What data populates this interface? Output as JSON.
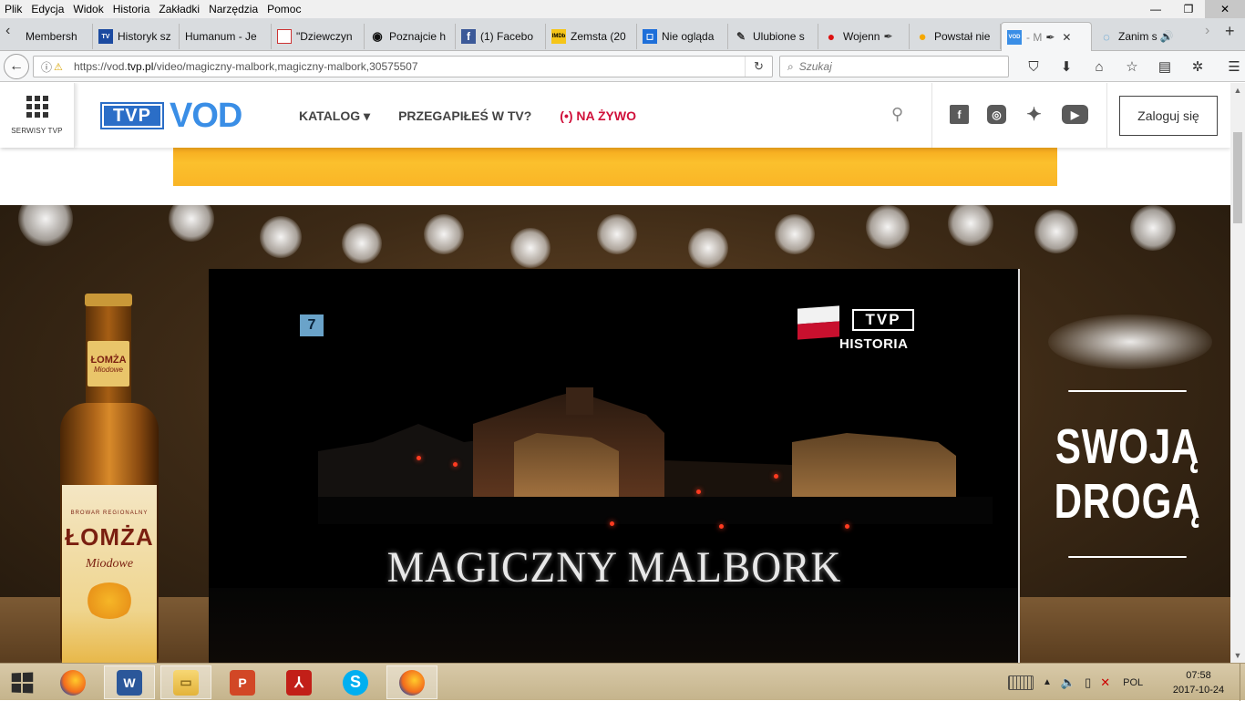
{
  "menubar": {
    "items": [
      "Plik",
      "Edycja",
      "Widok",
      "Historia",
      "Zakładki",
      "Narzędzia",
      "Pomoc"
    ]
  },
  "window_controls": {
    "minimize": "—",
    "restore": "❐",
    "close": "✕"
  },
  "tabs": [
    {
      "label": "Membersh",
      "icon": "chevron-left-icon"
    },
    {
      "label": "Historyk sz",
      "fav": "TV"
    },
    {
      "label": "Humanum - Je",
      "fav": ""
    },
    {
      "label": "\"Dziewczyn",
      "fav": ""
    },
    {
      "label": "Poznajcie h",
      "fav": "◉"
    },
    {
      "label": "(1) Facebo",
      "fav": "f"
    },
    {
      "label": "Zemsta (20",
      "fav": "IMDb"
    },
    {
      "label": "Nie ogląda",
      "fav": "◻"
    },
    {
      "label": "Ulubione s",
      "fav": "✎"
    },
    {
      "label": "Wojenn",
      "fav": "●"
    },
    {
      "label": "Powstał nie",
      "fav": "●"
    },
    {
      "label": "- M",
      "fav": "VOD"
    },
    {
      "label": "Zanim s",
      "fav": "◌"
    }
  ],
  "navbar": {
    "url_prefix": "https://vod.",
    "url_domain": "tvp.pl",
    "url_path": "/video/magiczny-malbork,magiczny-malbork,30575507",
    "search_placeholder": "Szukaj",
    "icons": [
      "pocket-icon",
      "download-icon",
      "home-icon",
      "bookmark-star-icon",
      "reader-icon",
      "extension-icon",
      "menu-icon"
    ]
  },
  "site": {
    "serwisy_label": "SERWISY TVP",
    "logo_tvp": "TVP",
    "logo_vod": "VOD",
    "nav": {
      "katalog": "KATALOG ▾",
      "przegapiles": "PRZEGAPIŁEŚ W TV?",
      "live": "(•) NA ŻYWO"
    },
    "login": "Zaloguj się",
    "social": [
      "f",
      "◎",
      "🐦",
      "▶"
    ]
  },
  "video": {
    "channel_badge": "7",
    "brand": "TVP",
    "brand_sub": "HISTORIA",
    "title": "MAGICZNY MALBORK"
  },
  "ad": {
    "bottle_neck_brand": "ŁOMŻA",
    "bottle_neck_sub": "Miodowe",
    "bottle_brewery": "BROWAR REGIONALNY",
    "bottle_brand": "ŁOMŻA",
    "bottle_sub": "Miodowe",
    "slogan_line1": "SWOJĄ",
    "slogan_line2": "DROGĄ"
  },
  "taskbar": {
    "lang": "POL",
    "time": "07:58",
    "date": "2017-10-24"
  }
}
